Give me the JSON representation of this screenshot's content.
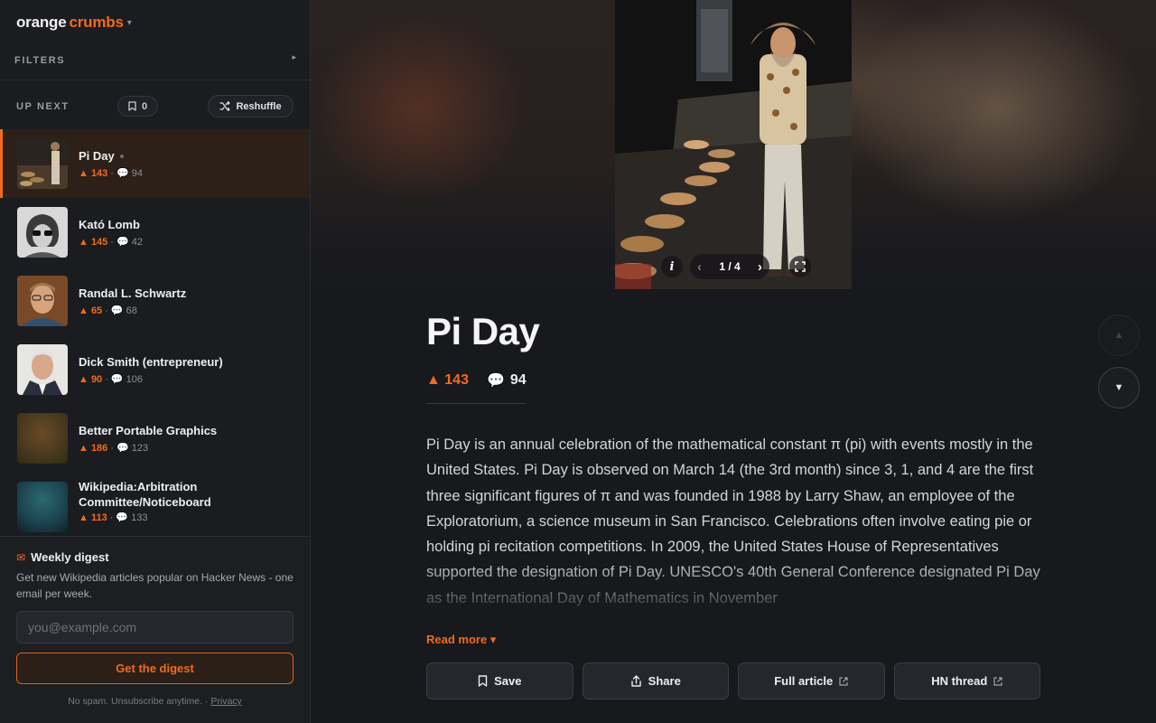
{
  "brand": {
    "part1": "orange",
    "part2": "crumbs",
    "caret": "▾"
  },
  "filters": {
    "label": "FILTERS",
    "arrow": "▸"
  },
  "upnext": {
    "label": "UP NEXT",
    "bookmark_count": "0",
    "reshuffle_label": "Reshuffle"
  },
  "list": [
    {
      "title": "Pi Day",
      "score": "▲ 143",
      "comments": "94",
      "active": true
    },
    {
      "title": "Kató Lomb",
      "score": "▲ 145",
      "comments": "42"
    },
    {
      "title": "Randal L. Schwartz",
      "score": "▲ 65",
      "comments": "68"
    },
    {
      "title": "Dick Smith (entrepreneur)",
      "score": "▲ 90",
      "comments": "106"
    },
    {
      "title": "Better Portable Graphics",
      "score": "▲ 186",
      "comments": "123"
    },
    {
      "title": "Wikipedia:Arbitration Committee/Noticeboard",
      "score": "▲ 113",
      "comments": "133"
    }
  ],
  "digest": {
    "icon": "✉",
    "title": "Weekly digest",
    "text": "Get new Wikipedia articles popular on Hacker News - one email per week.",
    "email_placeholder": "you@example.com",
    "button": "Get the digest",
    "foot_text": "No spam. Unsubscribe anytime. ·",
    "privacy": "Privacy"
  },
  "image_controls": {
    "info": "i",
    "prev": "‹",
    "counter": "1 / 4",
    "next": "›"
  },
  "article": {
    "title": "Pi Day",
    "score": "▲ 143",
    "comments": "94",
    "body": "Pi Day is an annual celebration of the mathematical constant π (pi) with events mostly in the United States. Pi Day is observed on March 14 (the 3rd month) since 3, 1, and 4 are the first three significant figures of π and was founded in 1988 by Larry Shaw, an employee of the Exploratorium, a science museum in San Francisco. Celebrations often involve eating pie or holding pi recitation competitions. In 2009, the United States House of Representatives supported the designation of Pi Day. UNESCO's 40th General Conference designated Pi Day as the International Day of Mathematics in November",
    "read_more": "Read more ▾"
  },
  "actions": {
    "save": "Save",
    "share": "Share",
    "full_article": "Full article",
    "hn_thread": "HN thread"
  },
  "nav": {
    "up": "▲",
    "down": "▼"
  },
  "colors": {
    "accent": "#f26a1b",
    "background": "#17191d",
    "sidebar": "#1a1c20"
  }
}
